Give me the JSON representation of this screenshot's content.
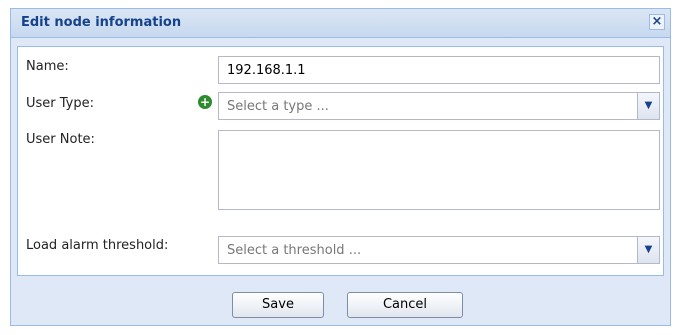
{
  "dialog": {
    "title": "Edit node information",
    "close_label": "×"
  },
  "form": {
    "name_label": "Name:",
    "name_value": "192.168.1.1",
    "user_type_label": "User Type:",
    "user_type_placeholder": "Select a type ...",
    "user_note_label": "User Note:",
    "user_note_value": "",
    "threshold_label": "Load alarm threshold:",
    "threshold_placeholder": "Select a threshold ..."
  },
  "buttons": {
    "save": "Save",
    "cancel": "Cancel"
  },
  "icons": {
    "add": "plus-circle-icon",
    "dropdown": "chevron-down-icon",
    "close": "close-icon"
  },
  "colors": {
    "title_text": "#15428b",
    "border": "#99bbe8",
    "panel_bg": "#dfe8f6",
    "add_icon": "#2e8b2e"
  }
}
